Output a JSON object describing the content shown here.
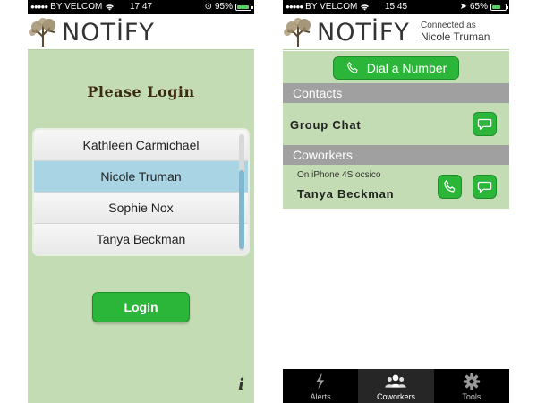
{
  "left_screen": {
    "status": {
      "signal": "●●●●●",
      "carrier": "BY VELCOM",
      "time": "17:47",
      "battery": "95%",
      "battery_level": 0.95
    },
    "brand": "NOTİFY",
    "title": "Please Login",
    "users": [
      "Kathleen Carmichael",
      "Nicole Truman",
      "Sophie Nox",
      "Tanya Beckman"
    ],
    "selected_user": "Nicole Truman",
    "login_label": "Login",
    "info_label": "i"
  },
  "right_screen": {
    "status": {
      "signal": "●●●●●",
      "carrier": "BY VELCOM",
      "time": "15:45",
      "battery": "65%",
      "battery_level": 0.65
    },
    "brand": "NOTİFY",
    "connected_label": "Connected as",
    "connected_user": "Nicole Truman",
    "dial_label": "Dial a Number",
    "contacts_header": "Contacts",
    "group_chat_label": "Group Chat",
    "coworkers_header": "Coworkers",
    "coworker": {
      "status": "On iPhone 4S ocsico",
      "name": "Tanya Beckman"
    },
    "tabs": [
      {
        "label": "Alerts",
        "icon": "lightning-icon",
        "active": false
      },
      {
        "label": "Coworkers",
        "icon": "people-icon",
        "active": true
      },
      {
        "label": "Tools",
        "icon": "gear-icon",
        "active": false
      }
    ]
  },
  "colors": {
    "background_green": "#c4dcb4",
    "accent_green": "#2bb63a",
    "selected_row": "#a8d4e3",
    "section_gray": "#a0a0a0"
  }
}
